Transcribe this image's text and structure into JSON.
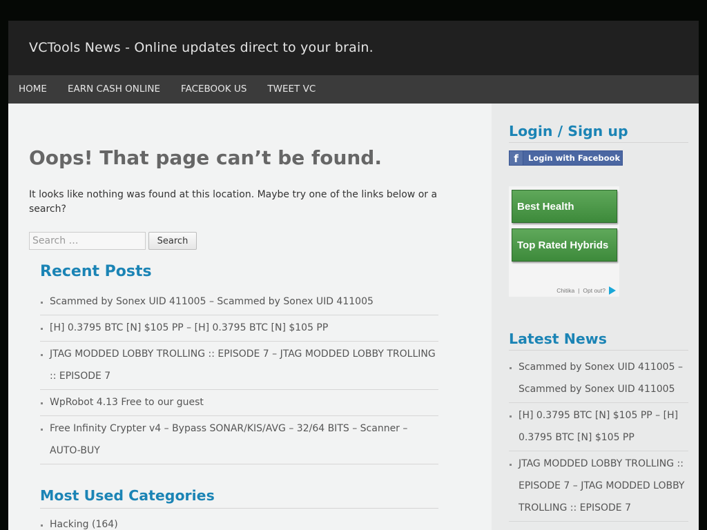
{
  "site": {
    "title": "VCTools News - Online updates direct to your brain."
  },
  "nav": {
    "items": [
      {
        "label": "HOME"
      },
      {
        "label": "EARN CASH ONLINE"
      },
      {
        "label": "FACEBOOK US"
      },
      {
        "label": "TWEET VC"
      }
    ]
  },
  "main": {
    "title": "Oops! That page can’t be found.",
    "message": "It looks like nothing was found at this location. Maybe try one of the links below or a search?",
    "search": {
      "placeholder": "Search …",
      "button_label": "Search"
    },
    "recent_posts": {
      "title": "Recent Posts",
      "items": [
        {
          "label": "Scammed by Sonex UID 411005 – Scammed by Sonex UID 411005"
        },
        {
          "label": "[H] 0.3795 BTC [N] $105 PP – [H] 0.3795 BTC [N] $105 PP"
        },
        {
          "label": "JTAG MODDED LOBBY TROLLING :: EPISODE 7 – JTAG MODDED LOBBY TROLLING :: EPISODE 7"
        },
        {
          "label": "WpRobot 4.13 Free to our guest"
        },
        {
          "label": "Free Infinity Crypter v4 – Bypass SONAR/KIS/AVG – 32/64 BITS – Scanner – AUTO-BUY"
        }
      ]
    },
    "categories": {
      "title": "Most Used Categories",
      "items": [
        {
          "label": "Hacking",
          "count": "(164)"
        }
      ]
    }
  },
  "sidebar": {
    "login_title": "Login / Sign up",
    "facebook_login_label": "Login with Facebook",
    "ad": {
      "buttons": [
        {
          "label": "Best Health"
        },
        {
          "label": "Top Rated Hybrids"
        }
      ],
      "brand": "Chitika",
      "separator": "|",
      "opt_out": "Opt out?"
    },
    "latest_news": {
      "title": "Latest News",
      "items": [
        {
          "label": "Scammed by Sonex UID 411005 – Scammed by Sonex UID 411005"
        },
        {
          "label": "[H] 0.3795 BTC [N] $105 PP – [H] 0.3795 BTC [N] $105 PP"
        },
        {
          "label": "JTAG MODDED LOBBY TROLLING :: EPISODE 7 – JTAG MODDED LOBBY TROLLING :: EPISODE 7"
        }
      ]
    }
  },
  "colors": {
    "accent": "#1b84b5",
    "header_bg": "#202020",
    "nav_bg": "#3b3b3b",
    "ad_green": "#4c9a48",
    "facebook_blue": "#4b67a2"
  }
}
